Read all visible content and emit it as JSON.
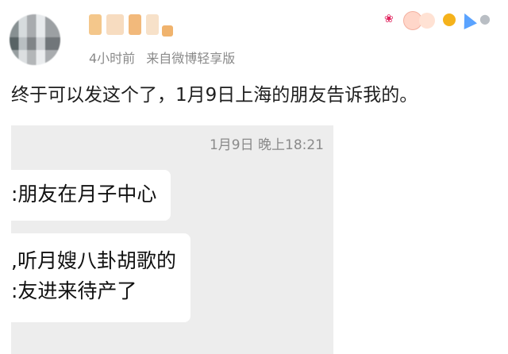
{
  "post": {
    "meta_time": "4小时前",
    "meta_source": "来自微博轻享版",
    "text": "终于可以发这个了，1月9日上海的朋友告诉我的。"
  },
  "badges": {
    "icons": [
      "ribbon-icon",
      "face-icon",
      "face-icon",
      "coin-icon",
      "party-hat-icon",
      "drop-icon"
    ]
  },
  "chat": {
    "timestamp": "1月9日 晚上18:21",
    "bubbles": [
      {
        "lines": [
          ":朋友在月子中心"
        ]
      },
      {
        "lines": [
          ",听月嫂八卦胡歌的",
          ":友进来待产了"
        ]
      }
    ]
  }
}
